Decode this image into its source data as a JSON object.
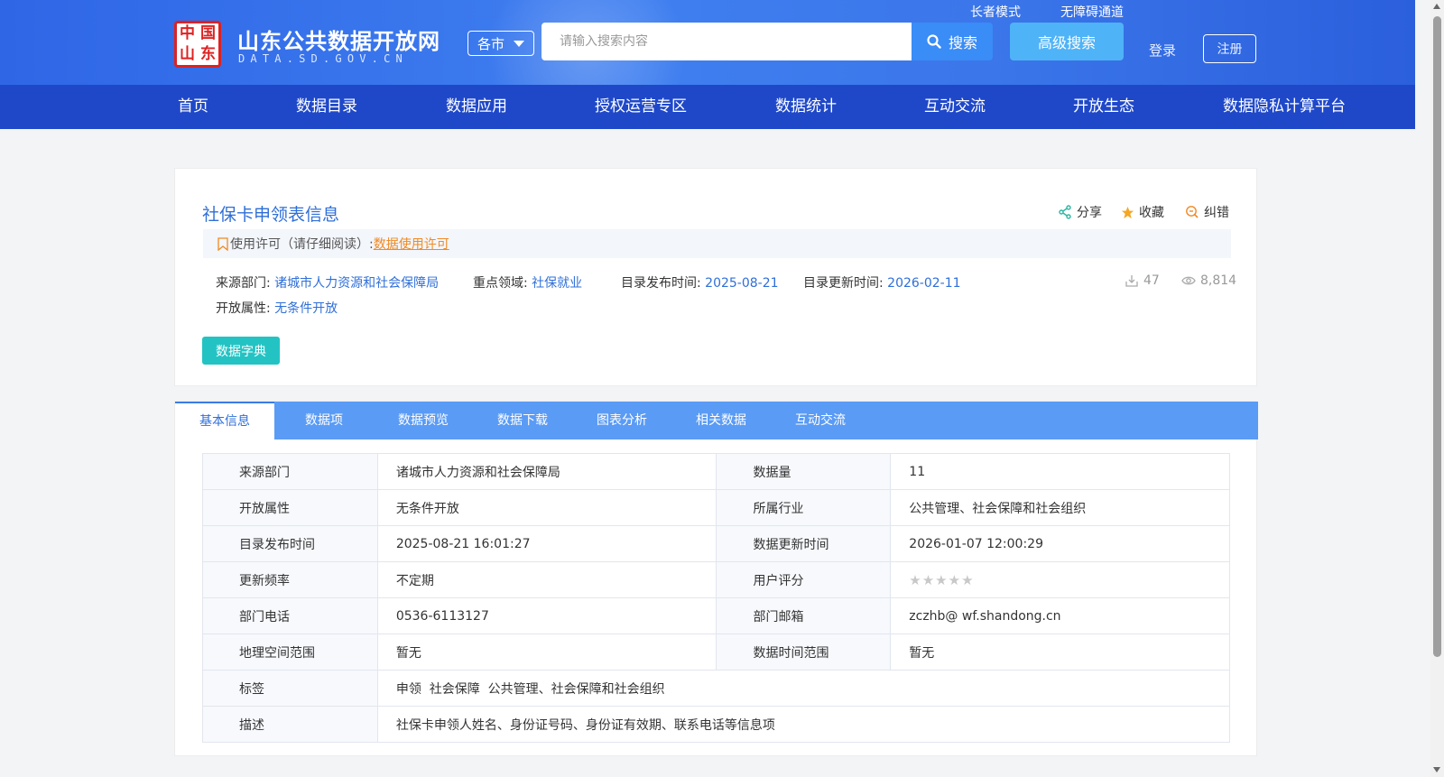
{
  "header": {
    "site_title": "山东公共数据开放网",
    "site_subtitle": "DATA.SD.GOV.CN",
    "logo_chars": [
      "中",
      "国",
      "山",
      "东"
    ],
    "city_select": "各市",
    "search_placeholder": "请输入搜索内容",
    "search_button": "搜索",
    "advanced_search": "高级搜索",
    "elder_mode": "长者模式",
    "accessibility": "无障碍通道",
    "login": "登录",
    "register": "注册"
  },
  "nav": [
    "首页",
    "数据目录",
    "数据应用",
    "授权运营专区",
    "数据统计",
    "互动交流",
    "开放生态",
    "数据隐私计算平台"
  ],
  "dataset": {
    "title": "社保卡申领表信息",
    "actions": {
      "share": "分享",
      "favorite": "收藏",
      "report": "纠错"
    },
    "license_label": "使用许可（请仔细阅读）:",
    "license_link": "数据使用许可",
    "meta": {
      "source_label": "来源部门:",
      "source_value": "诸城市人力资源和社会保障局",
      "domain_label": "重点领域:",
      "domain_value": "社保就业",
      "publish_label": "目录发布时间:",
      "publish_value": "2025-08-21",
      "update_label": "目录更新时间:",
      "update_value": "2026-02-11",
      "open_label": "开放属性:",
      "open_value": "无条件开放"
    },
    "downloads": "47",
    "views": "8,814",
    "dict_button": "数据字典"
  },
  "tabs": [
    "基本信息",
    "数据项",
    "数据预览",
    "数据下载",
    "图表分析",
    "相关数据",
    "互动交流"
  ],
  "info_table": {
    "rows": [
      [
        "来源部门",
        "诸城市人力资源和社会保障局",
        "数据量",
        "11"
      ],
      [
        "开放属性",
        "无条件开放",
        "所属行业",
        "公共管理、社会保障和社会组织"
      ],
      [
        "目录发布时间",
        "2025-08-21 16:01:27",
        "数据更新时间",
        "2026-01-07 12:00:29"
      ],
      [
        "更新频率",
        "不定期",
        "用户评分",
        "★★★★★"
      ],
      [
        "部门电话",
        "0536-6113127",
        "部门邮箱",
        "zczhb@ wf.shandong.cn"
      ],
      [
        "地理空间范围",
        "暂无",
        "数据时间范围",
        "暂无"
      ]
    ],
    "tags_label": "标签",
    "tags_value": "申领  社会保障  公共管理、社会保障和社会组织",
    "desc_label": "描述",
    "desc_value": "社保卡申领人姓名、身份证号码、身份证有效期、联系电话等信息项"
  },
  "colors": {
    "header_blue": "#3a76ea",
    "nav_blue": "#1f48c9",
    "tab_blue": "#5a9bf5",
    "link_blue": "#2f6fd8",
    "accent_teal": "#23c3c3",
    "license_orange": "#f08a24"
  }
}
